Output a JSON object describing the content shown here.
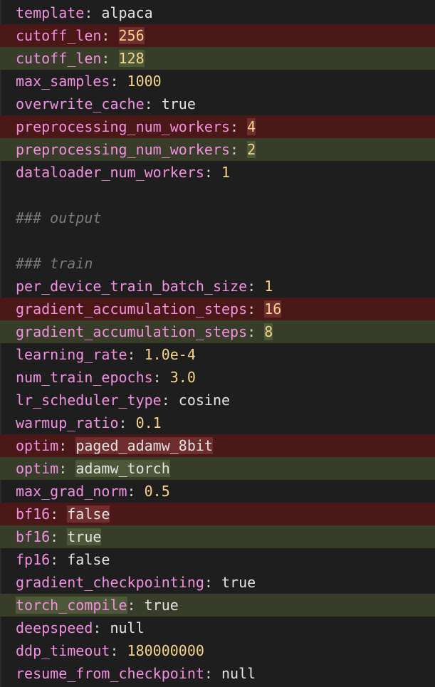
{
  "lines": [
    {
      "key": "template",
      "value": "alpaca",
      "type": "str",
      "diff": ""
    },
    {
      "key": "cutoff_len",
      "value": "256",
      "type": "num",
      "diff": "removed"
    },
    {
      "key": "cutoff_len",
      "value": "128",
      "type": "num",
      "diff": "added"
    },
    {
      "key": "max_samples",
      "value": "1000",
      "type": "num",
      "diff": ""
    },
    {
      "key": "overwrite_cache",
      "value": "true",
      "type": "str",
      "diff": ""
    },
    {
      "key": "preprocessing_num_workers",
      "value": "4",
      "type": "num",
      "diff": "removed"
    },
    {
      "key": "preprocessing_num_workers",
      "value": "2",
      "type": "num",
      "diff": "added"
    },
    {
      "key": "dataloader_num_workers",
      "value": "1",
      "type": "num",
      "diff": ""
    },
    {
      "comment": "",
      "diff": ""
    },
    {
      "comment": "### output",
      "diff": ""
    },
    {
      "comment": "",
      "diff": ""
    },
    {
      "comment": "### train",
      "diff": ""
    },
    {
      "key": "per_device_train_batch_size",
      "value": "1",
      "type": "num",
      "diff": ""
    },
    {
      "key": "gradient_accumulation_steps",
      "value": "16",
      "type": "num",
      "diff": "removed"
    },
    {
      "key": "gradient_accumulation_steps",
      "value": "8",
      "type": "num",
      "diff": "added"
    },
    {
      "key": "learning_rate",
      "value": "1.0e-4",
      "type": "num",
      "diff": ""
    },
    {
      "key": "num_train_epochs",
      "value": "3.0",
      "type": "num",
      "diff": ""
    },
    {
      "key": "lr_scheduler_type",
      "value": "cosine",
      "type": "str",
      "diff": ""
    },
    {
      "key": "warmup_ratio",
      "value": "0.1",
      "type": "num",
      "diff": ""
    },
    {
      "key": "optim",
      "value": "paged_adamw_8bit",
      "type": "str",
      "diff": "removed"
    },
    {
      "key": "optim",
      "value": "adamw_torch",
      "type": "str",
      "diff": "added"
    },
    {
      "key": "max_grad_norm",
      "value": "0.5",
      "type": "num",
      "diff": ""
    },
    {
      "key": "bf16",
      "value": "false",
      "type": "str",
      "diff": "removed"
    },
    {
      "key": "bf16",
      "value": "true",
      "type": "str",
      "diff": "added"
    },
    {
      "key": "fp16",
      "value": "false",
      "type": "str",
      "diff": ""
    },
    {
      "key": "gradient_checkpointing",
      "value": "true",
      "type": "str",
      "diff": ""
    },
    {
      "key": "torch_compile",
      "value": "true",
      "type": "str",
      "diff": "added-line"
    },
    {
      "key": "deepspeed",
      "value": "null",
      "type": "str",
      "diff": ""
    },
    {
      "key": "ddp_timeout",
      "value": "180000000",
      "type": "num",
      "diff": ""
    },
    {
      "key": "resume_from_checkpoint",
      "value": "null",
      "type": "str",
      "diff": ""
    }
  ],
  "colors": {
    "background": "#1e1e1e",
    "removed_line": "#4b1818",
    "added_line": "#373d29",
    "key": "#f28fe0",
    "number": "#f5d48a",
    "string": "#e4e4e4",
    "comment": "#7a7a7a"
  }
}
